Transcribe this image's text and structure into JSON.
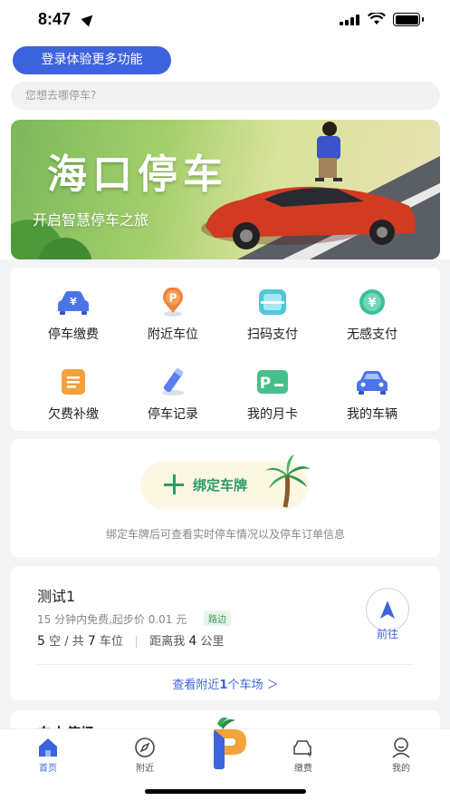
{
  "status_bar": {
    "time": "8:47"
  },
  "header": {
    "login_label": "登录体验更多功能",
    "search_placeholder": "您想去哪停车?"
  },
  "banner": {
    "title": "海口停车",
    "subtitle": "开启智慧停车之旅"
  },
  "grid": {
    "items": [
      {
        "label": "停车缴费",
        "icon": "car-yuan-icon"
      },
      {
        "label": "附近车位",
        "icon": "parking-pin-icon"
      },
      {
        "label": "扫码支付",
        "icon": "scan-icon"
      },
      {
        "label": "无感支付",
        "icon": "yuan-circle-icon"
      },
      {
        "label": "欠费补缴",
        "icon": "bill-icon"
      },
      {
        "label": "停车记录",
        "icon": "pen-icon"
      },
      {
        "label": "我的月卡",
        "icon": "card-icon"
      },
      {
        "label": "我的车辆",
        "icon": "car-icon"
      }
    ]
  },
  "bind": {
    "button_label": "绑定车牌",
    "tip": "绑定车牌后可查看实时停车情况以及停车订单信息"
  },
  "lot": {
    "name": "测试1",
    "price": "15 分钟内免费,起步价 0.01 元",
    "tag": "路边",
    "free": "5",
    "free_label": "空 / 共",
    "total": "7",
    "total_label": "车位",
    "distance_label": "距离我",
    "distance": "4",
    "distance_unit": "公里",
    "go_label": "前往",
    "nearby_prefix": "查看附近",
    "nearby_count": "1",
    "nearby_suffix": "个车场 ＞"
  },
  "peek": {
    "title": "白土停场"
  },
  "tabs": [
    {
      "label": "首页",
      "icon": "home-icon",
      "active": true
    },
    {
      "label": "附近",
      "icon": "compass-icon",
      "active": false
    },
    {
      "label": "缴费",
      "icon": "car-pay-icon",
      "active": false
    },
    {
      "label": "我的",
      "icon": "user-icon",
      "active": false
    }
  ],
  "colors": {
    "accent": "#3d63dd",
    "green": "#2e9a6a"
  }
}
